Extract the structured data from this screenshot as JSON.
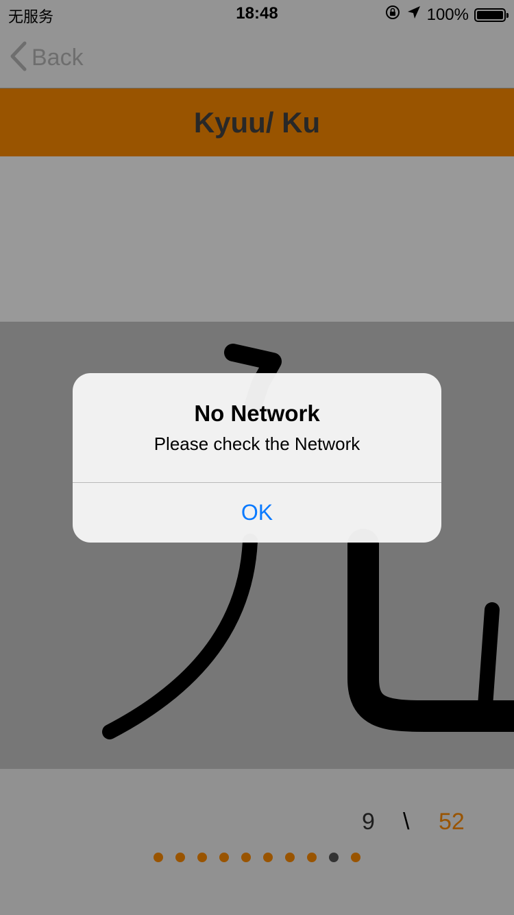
{
  "status_bar": {
    "carrier": "无服务",
    "time": "18:48",
    "battery": "100%",
    "icons": [
      "orientation-lock-icon",
      "location-arrow-icon",
      "battery-icon"
    ]
  },
  "nav": {
    "back_label": "Back",
    "back_icon": "chevron-left-icon"
  },
  "header": {
    "title": "Kyuu/ Ku",
    "color": "#ff8c00"
  },
  "stroke_image": {
    "character": "九"
  },
  "pager": {
    "current": "9",
    "separator": "\\",
    "total": "52",
    "dot_count": 10,
    "active_dot_index": 8
  },
  "alert": {
    "title": "No Network",
    "message": "Please check the Network",
    "ok_label": "OK"
  },
  "colors": {
    "accent": "#ff8c00",
    "alert_button": "#0a7aff"
  }
}
